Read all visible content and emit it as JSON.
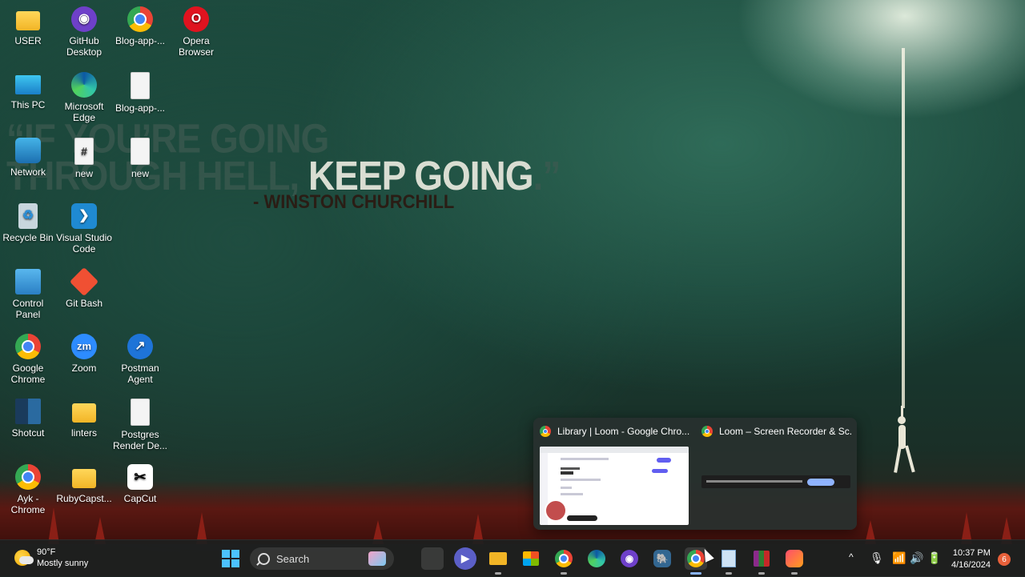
{
  "wallpaper": {
    "quote_line1": "“IF YOU’RE GOING",
    "quote_line2_a": "THROUGH HELL, ",
    "quote_line2_b": "KEEP GOING",
    "quote_line2_c": ".”",
    "quote_author": "- WINSTON CHURCHILL"
  },
  "desktop_icons": [
    {
      "label": "USER",
      "icon": "folder-icon"
    },
    {
      "label": "GitHub Desktop",
      "icon": "github-desktop-icon"
    },
    {
      "label": "Blog-app-...",
      "icon": "chrome-icon"
    },
    {
      "label": "Opera Browser",
      "icon": "opera-icon"
    },
    {
      "label": "This PC",
      "icon": "monitor-icon"
    },
    {
      "label": "Microsoft Edge",
      "icon": "edge-icon"
    },
    {
      "label": "Blog-app-...",
      "icon": "document-icon"
    },
    {
      "label": "Network",
      "icon": "network-icon"
    },
    {
      "label": "new",
      "icon": "document-icon"
    },
    {
      "label": "new",
      "icon": "document-icon"
    },
    {
      "label": "Recycle Bin",
      "icon": "recycle-bin-icon"
    },
    {
      "label": "Visual Studio Code",
      "icon": "vscode-icon"
    },
    {
      "label": "Control Panel",
      "icon": "control-panel-icon"
    },
    {
      "label": "Git Bash",
      "icon": "git-bash-icon"
    },
    {
      "label": "Google Chrome",
      "icon": "chrome-icon"
    },
    {
      "label": "Zoom",
      "icon": "zoom-icon"
    },
    {
      "label": "Postman Agent",
      "icon": "postman-icon"
    },
    {
      "label": "Shotcut",
      "icon": "shotcut-icon"
    },
    {
      "label": "linters",
      "icon": "folder-icon"
    },
    {
      "label": "Postgres Render De...",
      "icon": "document-icon"
    },
    {
      "label": "Ayk - Chrome",
      "icon": "chrome-icon"
    },
    {
      "label": "RubyCapst...",
      "icon": "folder-icon"
    },
    {
      "label": "CapCut",
      "icon": "capcut-icon"
    }
  ],
  "thumbnail_popup": {
    "windows": [
      {
        "title": "Library | Loom - Google Chro..."
      },
      {
        "title": "Loom – Screen Recorder & Sc..."
      }
    ]
  },
  "taskbar": {
    "weather_temp": "90°F",
    "weather_desc": "Mostly sunny",
    "search_label": "Search",
    "time": "10:37 PM",
    "date": "4/16/2024",
    "notification_count": "6",
    "tray_overflow_glyph": "^"
  },
  "colors": {
    "accent": "#4cc2ff",
    "taskbar_bg": "#1c201f",
    "notification_badge": "#e8603a"
  }
}
